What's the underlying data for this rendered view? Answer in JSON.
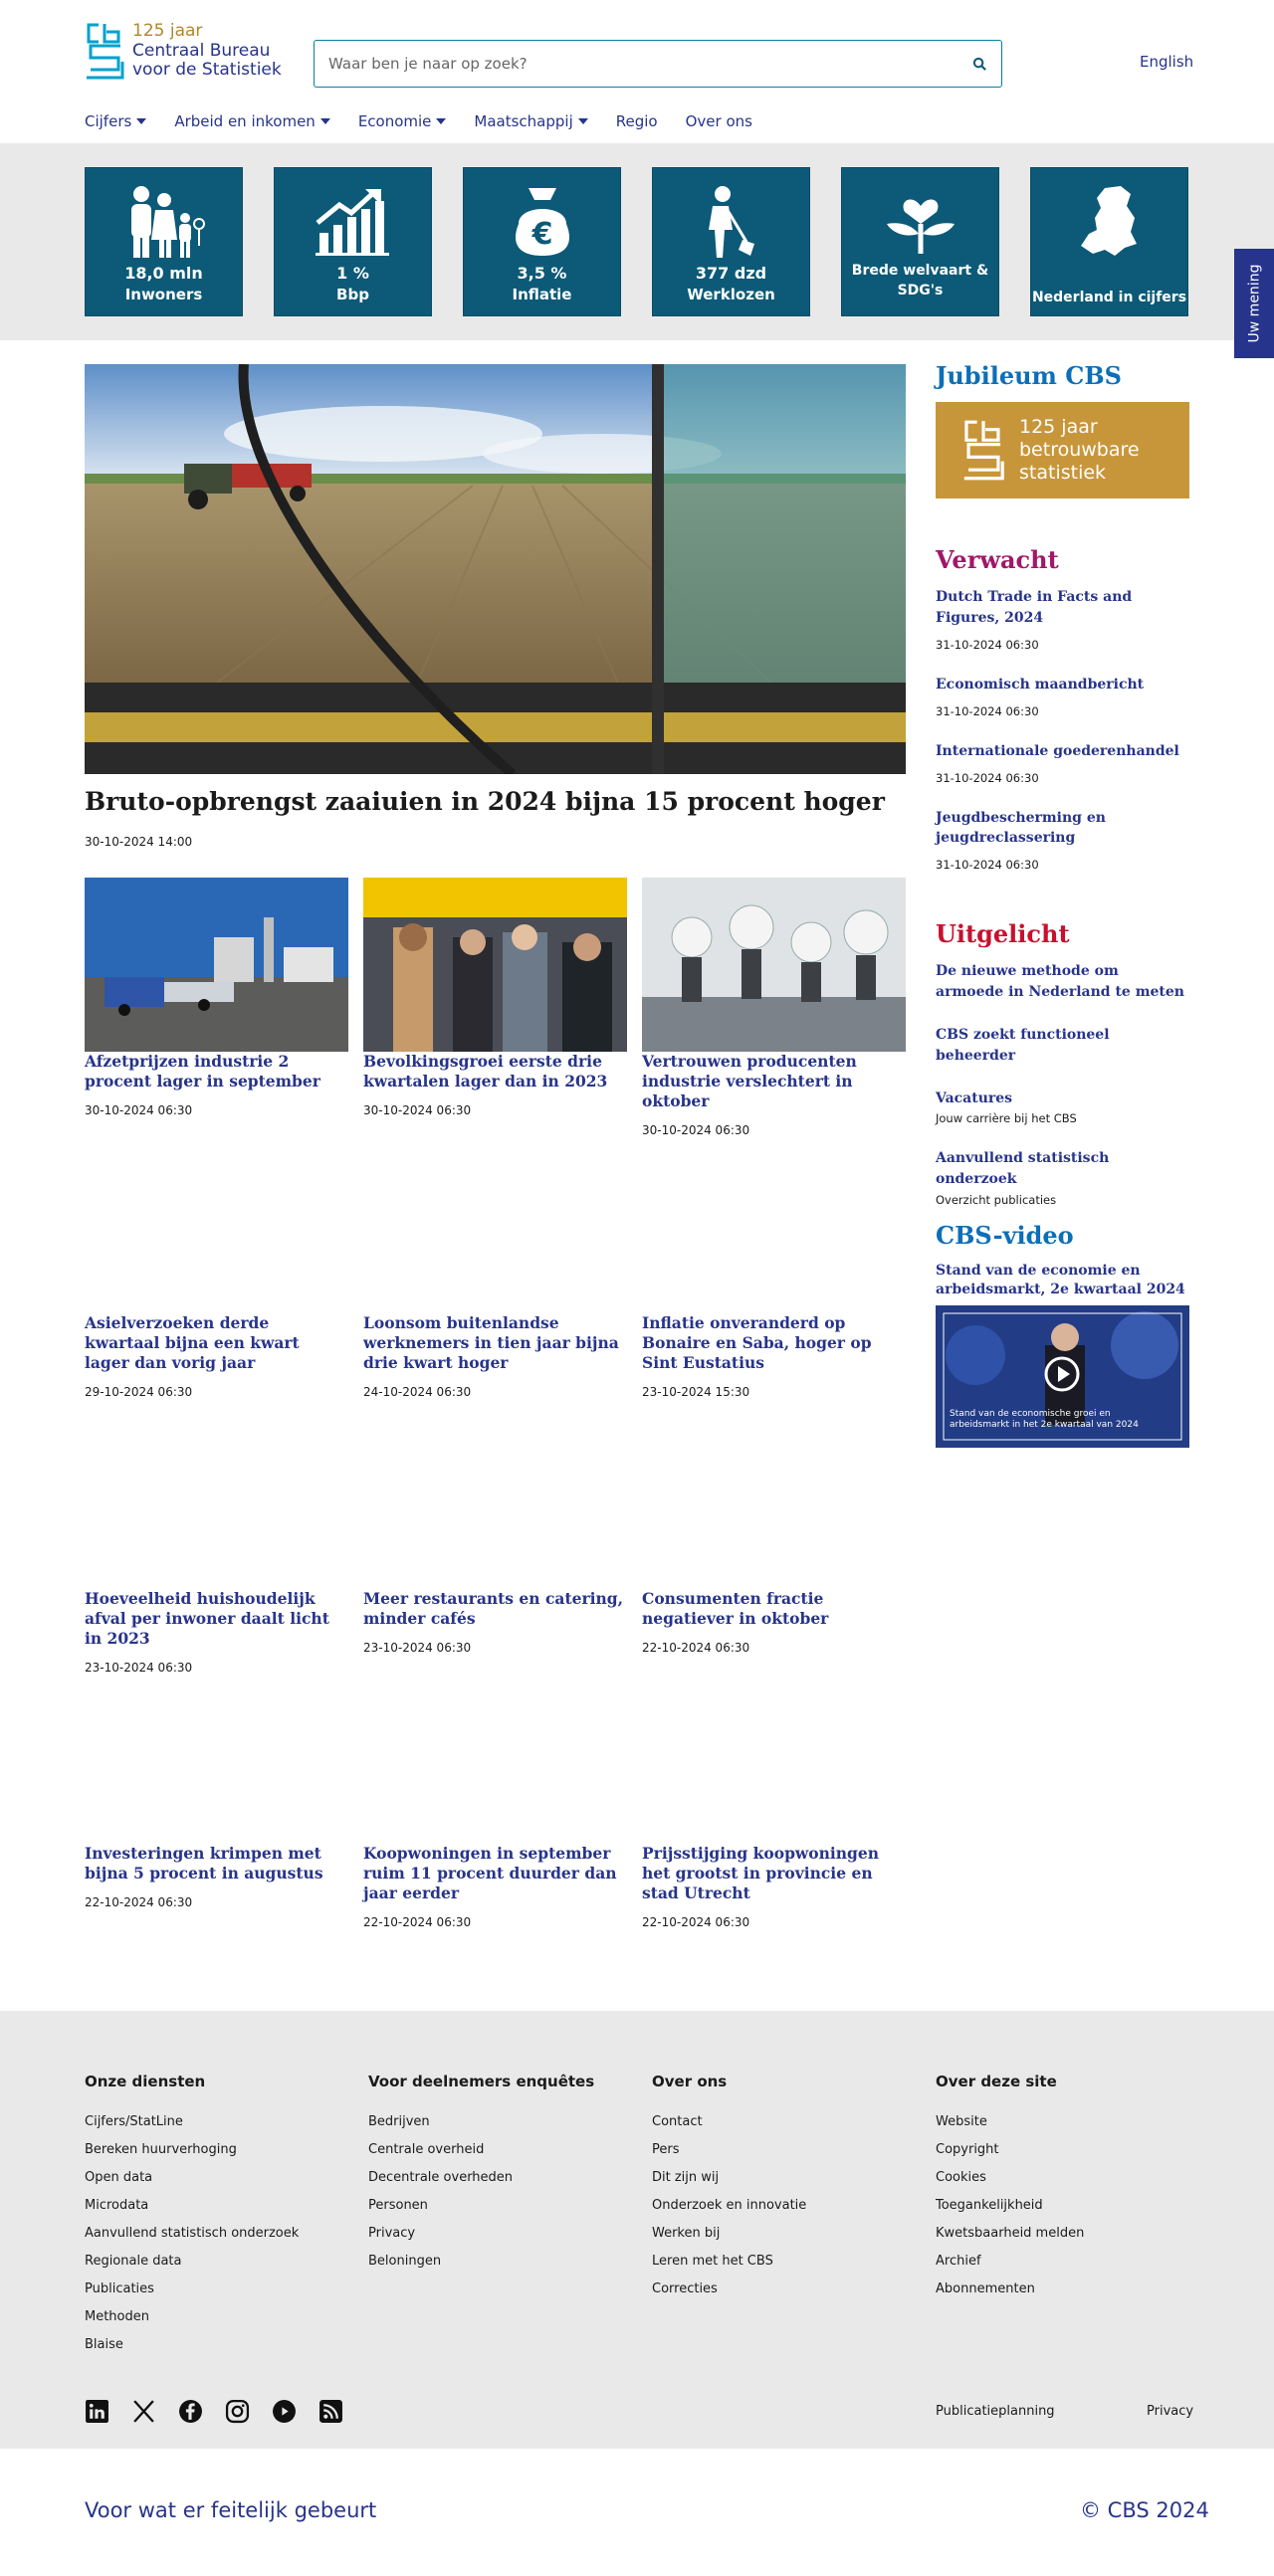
{
  "header": {
    "logo_years": "125 jaar",
    "logo_name_1": "Centraal Bureau",
    "logo_name_2": "voor de Statistiek",
    "search_placeholder": "Waar ben je naar op zoek?",
    "language_link": "English"
  },
  "nav": [
    {
      "label": "Cijfers",
      "dropdown": true
    },
    {
      "label": "Arbeid en inkomen",
      "dropdown": true
    },
    {
      "label": "Economie",
      "dropdown": true
    },
    {
      "label": "Maatschappij",
      "dropdown": true
    },
    {
      "label": "Regio",
      "dropdown": false
    },
    {
      "label": "Over ons",
      "dropdown": false
    }
  ],
  "tiles": [
    {
      "value": "18,0 mln",
      "label": "Inwoners",
      "icon": "people-icon"
    },
    {
      "value": "1 %",
      "label": "Bbp",
      "icon": "growth-chart-icon"
    },
    {
      "value": "3,5 %",
      "label": "Inflatie",
      "icon": "euro-bag-icon"
    },
    {
      "value": "377 dzd",
      "label": "Werklozen",
      "icon": "worker-shovel-icon"
    },
    {
      "label_line1": "Brede welvaart &",
      "label_line2": "SDG's",
      "icon": "hand-plant-heart-icon"
    },
    {
      "label": "Nederland in cijfers",
      "icon": "netherlands-map-icon"
    }
  ],
  "feedback_tab": "Uw mening",
  "hero": {
    "title": "Bruto-opbrengst zaaiuien in 2024 bijna 15 procent hoger",
    "date": "30-10-2024 14:00"
  },
  "articles": [
    {
      "title": "Afzetprijzen industrie 2 procent lager in september",
      "date": "30-10-2024 06:30"
    },
    {
      "title": "Bevolkingsgroei eerste drie kwartalen lager dan in 2023",
      "date": "30-10-2024 06:30"
    },
    {
      "title": "Vertrouwen producenten industrie verslechtert in oktober",
      "date": "30-10-2024 06:30"
    },
    {
      "title": "Asielverzoeken derde kwartaal bijna een kwart lager dan vorig jaar",
      "date": "29-10-2024 06:30"
    },
    {
      "title": "Loonsom buitenlandse werknemers in tien jaar bijna drie kwart hoger",
      "date": "24-10-2024 06:30"
    },
    {
      "title": "Inflatie onveranderd op Bonaire en Saba, hoger op Sint Eustatius",
      "date": "23-10-2024 15:30"
    },
    {
      "title": "Hoeveelheid huishoudelijk afval per inwoner daalt licht in 2023",
      "date": "23-10-2024 06:30"
    },
    {
      "title": "Meer restaurants en catering, minder cafés",
      "date": "23-10-2024 06:30"
    },
    {
      "title": "Consumenten fractie negatiever in oktober",
      "date": "22-10-2024 06:30"
    },
    {
      "title": "Investeringen krimpen met bijna 5 procent in augustus",
      "date": "22-10-2024 06:30"
    },
    {
      "title": "Koopwoningen in september ruim 11 procent duurder dan jaar eerder",
      "date": "22-10-2024 06:30"
    },
    {
      "title": "Prijsstijging koopwoningen het grootst in provincie en stad Utrecht",
      "date": "22-10-2024 06:30"
    }
  ],
  "sidebar": {
    "jubileum_heading": "Jubileum CBS",
    "jubileum_banner_1": "125 jaar",
    "jubileum_banner_2": "betrouwbare",
    "jubileum_banner_3": "statistiek",
    "verwacht_heading": "Verwacht",
    "verwacht": [
      {
        "title": "Dutch Trade in Facts and Figures, 2024",
        "date": "31-10-2024 06:30"
      },
      {
        "title": "Economisch maandbericht",
        "date": "31-10-2024 06:30"
      },
      {
        "title": "Internationale goederenhandel",
        "date": "31-10-2024 06:30"
      },
      {
        "title": "Jeugdbescherming en jeugdreclassering",
        "date": "31-10-2024 06:30"
      }
    ],
    "uitgelicht_heading": "Uitgelicht",
    "uitgelicht": [
      {
        "title": "De nieuwe methode om armoede in Nederland te meten",
        "sub": ""
      },
      {
        "title": "CBS zoekt functioneel beheerder",
        "sub": ""
      },
      {
        "title": "Vacatures",
        "sub": "Jouw carrière bij het CBS"
      },
      {
        "title": "Aanvullend statistisch onderzoek",
        "sub": "Overzicht publicaties"
      }
    ],
    "video_heading": "CBS-video",
    "video_title": "Stand van de economie en arbeidsmarkt, 2e kwartaal 2024",
    "video_caption": "Stand van de economische groei en arbeidsmarkt in het 2e kwartaal van 2024"
  },
  "footer": {
    "columns": [
      {
        "heading": "Onze diensten",
        "links": [
          "Cijfers/StatLine",
          "Bereken huurverhoging",
          "Open data",
          "Microdata",
          "Aanvullend statistisch onderzoek",
          "Regionale data",
          "Publicaties",
          "Methoden",
          "Blaise"
        ]
      },
      {
        "heading": "Voor deelnemers enquêtes",
        "links": [
          "Bedrijven",
          "Centrale overheid",
          "Decentrale overheden",
          "Personen",
          "Privacy",
          "Beloningen"
        ]
      },
      {
        "heading": "Over ons",
        "links": [
          "Contact",
          "Pers",
          "Dit zijn wij",
          "Onderzoek en innovatie",
          "Werken bij",
          "Leren met het CBS",
          "Correcties"
        ]
      },
      {
        "heading": "Over deze site",
        "links": [
          "Website",
          "Copyright",
          "Cookies",
          "Toegankelijkheid",
          "Kwetsbaarheid melden",
          "Archief",
          "Abonnementen"
        ]
      }
    ],
    "social": [
      "linkedin-icon",
      "x-icon",
      "facebook-icon",
      "instagram-icon",
      "youtube-icon",
      "rss-icon"
    ],
    "bottom_links": [
      "Publicatieplanning",
      "Privacy"
    ],
    "tagline": "Voor wat er feitelijk gebeurt",
    "copyright": "© CBS 2024"
  },
  "colors": {
    "brand_blue": "#27348b",
    "tile_blue": "#0c5a77",
    "jubileum_blue": "#0d6fb8",
    "verwacht_magenta": "#a01868",
    "uitgelicht_red": "#c8102e",
    "gold": "#c8963a"
  }
}
